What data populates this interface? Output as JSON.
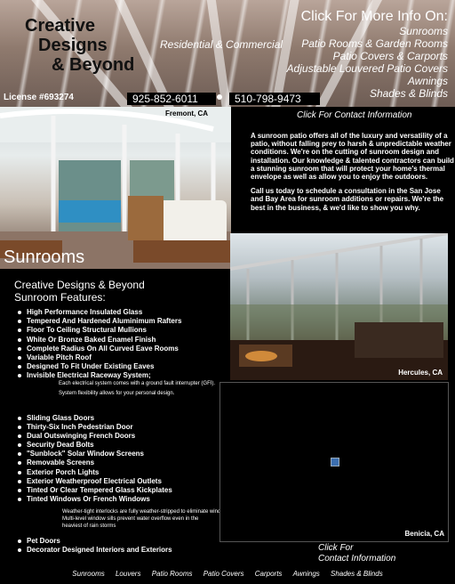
{
  "header": {
    "logo": {
      "line1": "Creative",
      "line2": "Designs",
      "line3": "& Beyond"
    },
    "tagline": "Residential & Commercial",
    "more_info_title": "Click For More Info On:",
    "more_info_items": [
      "Sunrooms",
      "Patio Rooms & Garden Rooms",
      "Patio Covers & Carports",
      "Adjustable Louvered Patio Covers",
      "Awnings",
      "Shades & Blinds"
    ],
    "license": "License #693274",
    "phone1": "925-852-6011",
    "phone2": "510-798-9473"
  },
  "photo1": {
    "city": "Fremont, CA",
    "section_title": "Sunrooms"
  },
  "contact_link": "Click For Contact Information",
  "intro": {
    "p1": "A sunroom patio offers all of the luxury and versatility of a patio, without falling prey to harsh & unpredictable weather conditions. We're on the cutting of sunroom design and installation. Our knowledge & talented contractors can build a stunning sunroom that will protect your home's thermal envelope as well as allow you to enjoy the outdoors.",
    "p2": "Call us today to schedule a consultation in the San Jose and Bay Area for sunroom additions or repairs. We're the best in the business, & we'd like to show you why."
  },
  "photo2": {
    "city": "Hercules, CA"
  },
  "features": {
    "title1": "Creative Designs & Beyond",
    "title2": "Sunroom Features:",
    "list1": [
      "High Performance Insulated Glass",
      "Tempered And Hardened Aluminimum Rafters",
      "Floor To Ceiling Structural Mullions",
      "White Or Bronze Baked Enamel Finish",
      "Complete Radius On All Curved Eave Rooms",
      "Variable Pitch Roof",
      "Designed To Fit Under Existing Eaves",
      "Invisible Electrical Raceway System;"
    ],
    "note1": [
      "Each electrical system comes with a ground fault interrupter (GFI).",
      "System flexibility allows for your personal design."
    ],
    "list2": [
      "Sliding Glass Doors",
      "Thirty-Six Inch Pedestrian Door",
      "Dual Outswinging French Doors",
      "Security Dead Bolts",
      "\"Sunblock\" Solar Window Screens",
      "Removable Screens",
      "Exterior Porch Lights",
      "Exterior Weatherproof Electrical Outlets",
      "Tinted Or Clear Tempered Glass Kickplates",
      "Tinted Windows Or French Windows"
    ],
    "note2": [
      "Weather-tight interlocks are fully weather-stripped to eliminate wind blow-by",
      "Multi-level window sills prevent water overflow even in the",
      "heaviest of rain storms"
    ],
    "list3": [
      "Pet Doors",
      "Decorator Designed Interiors and Exteriors"
    ]
  },
  "photo3": {
    "city": "Benicia, CA"
  },
  "contact2": {
    "line1": "Click For",
    "line2": "Contact Information"
  },
  "footer": [
    "Sunrooms",
    "Louvers",
    "Patio Rooms",
    "Patio Covers",
    "Carports",
    "Awnings",
    "Shades & Blinds"
  ]
}
